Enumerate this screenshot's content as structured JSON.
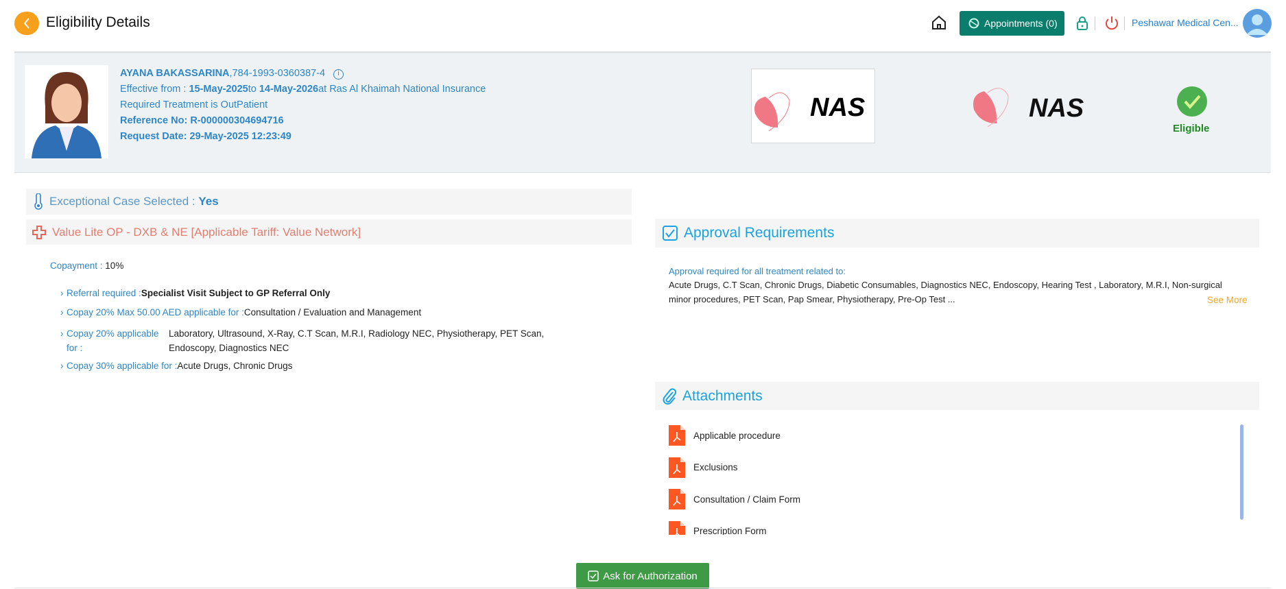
{
  "header": {
    "title": "Eligibility Details",
    "appointments_label": "Appointments (0)",
    "organization": "Peshawar Medical Cen..."
  },
  "patient": {
    "name": "AYANA BAKASSARINA",
    "id": ",784-1993-0360387-4",
    "effective_prefix": "Effective from : ",
    "effective_from": "15-May-2025",
    "to_label": "to ",
    "effective_to": "14-May-2026",
    "insurer": "at Ras Al Khaimah National Insurance",
    "treatment": "Required Treatment is OutPatient",
    "reference": "Reference No: R-000000304694716",
    "request_date": "Request Date: 29-May-2025 12:23:49"
  },
  "logos": {
    "text": "NAS"
  },
  "status": {
    "label": "Eligible",
    "color": "#4caf50"
  },
  "exceptional": {
    "label": "Exceptional Case Selected : ",
    "value": "Yes"
  },
  "plan": {
    "title": "Value Lite OP - DXB & NE [Applicable Tariff: Value Network]"
  },
  "copayment": {
    "label": "Copayment : ",
    "value": "10%"
  },
  "benefits": [
    {
      "label": "Referral required :",
      "value": "Specialist Visit Subject to GP Referral Only"
    },
    {
      "label": "Copay 20% Max 50.00 AED applicable for :",
      "value": "Consultation / Evaluation and Management"
    },
    {
      "label": "Copay 20% applicable for :",
      "value": "Laboratory, Ultrasound, X-Ray, C.T Scan, M.R.I, Radiology NEC, Physiotherapy, PET Scan, Endoscopy, Diagnostics NEC"
    },
    {
      "label": "Copay 30% applicable for :",
      "value": "Acute Drugs, Chronic Drugs"
    }
  ],
  "approval": {
    "title": "Approval Requirements",
    "intro": "Approval required for all treatment related to:",
    "line1": "Acute Drugs, C.T Scan, Chronic Drugs, Diabetic Consumables, Diagnostics NEC, Endoscopy, Hearing Test , Laboratory, M.R.I, Non-surgical",
    "line2": "minor procedures, PET Scan, Pap Smear, Physiotherapy, Pre-Op Test ...",
    "see_more": "See More"
  },
  "attachments": {
    "title": "Attachments",
    "items": [
      "Applicable procedure",
      "Exclusions",
      "Consultation / Claim Form",
      "Prescription Form"
    ]
  },
  "actions": {
    "ask_authorization": "Ask for Authorization"
  }
}
